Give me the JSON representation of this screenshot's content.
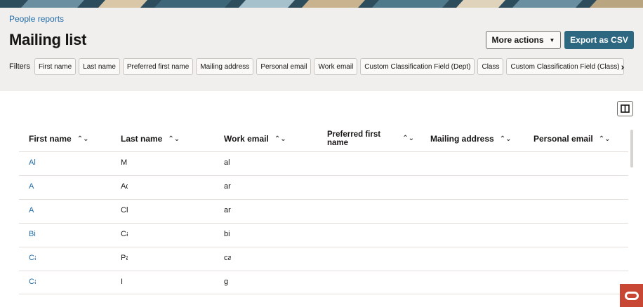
{
  "header": {
    "breadcrumb": "People reports",
    "title": "Mailing list",
    "more_actions_label": "More actions",
    "export_label": "Export as CSV"
  },
  "filters": {
    "label": "Filters",
    "chips": [
      "First name",
      "Last name",
      "Preferred first name",
      "Mailing address",
      "Personal email",
      "Work email",
      "Custom Classification Field (Dept)",
      "Class",
      "Custom Classification Field (Class)"
    ],
    "next_glyph": "›"
  },
  "table": {
    "sort_glyph": "⌃⌄",
    "columns": [
      "First name",
      "Last name",
      "Work email",
      "Preferred first name",
      "Mailing address",
      "Personal email"
    ],
    "rows": [
      {
        "first": "Al",
        "last": "M",
        "email": "al"
      },
      {
        "first": "A",
        "last": "Ac",
        "email": "ar"
      },
      {
        "first": "A",
        "last": "Cl",
        "email": "ar"
      },
      {
        "first": "Bi",
        "last": "Ca",
        "email": "bi"
      },
      {
        "first": "Ca",
        "last": "Pa",
        "email": "ca"
      },
      {
        "first": "Ca",
        "last": "I",
        "email": "g"
      }
    ]
  },
  "colors": {
    "accent": "#2e6780",
    "link": "#1f6aa6",
    "header_bg": "#f1efed",
    "oracle_red": "#c74634"
  },
  "icons": {
    "column_toggle": "columns-icon",
    "oracle": "oracle-logo-icon",
    "more_actions_caret": "caret-down-icon"
  }
}
